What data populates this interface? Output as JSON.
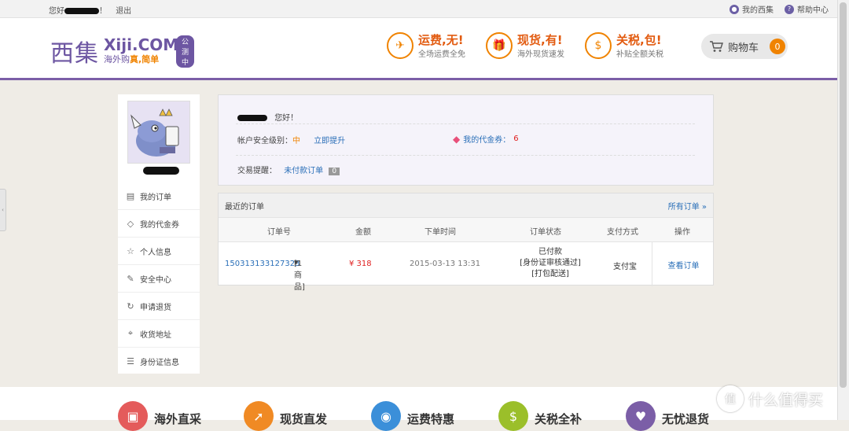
{
  "topbar": {
    "greeting": "您好",
    "greeting_suffix": "！",
    "logout": "退出",
    "my_xiji": "我的西集",
    "help": "帮助中心"
  },
  "logo": {
    "mark": "西集",
    "brand": "Xiji.COM",
    "beta": "公测中",
    "tagline_a": "海外购",
    "tagline_b": "真,简单"
  },
  "promos": [
    {
      "icon": "plane-icon",
      "glyph": "✈",
      "title": "运费,无!",
      "sub": "全场运费全免"
    },
    {
      "icon": "gift-icon",
      "glyph": "🎁",
      "title": "现货,有!",
      "sub": "海外现货速发"
    },
    {
      "icon": "money-bag-icon",
      "glyph": "$",
      "title": "关税,包!",
      "sub": "补贴全额关税"
    }
  ],
  "cart": {
    "label": "购物车",
    "count": "0"
  },
  "sidebar": {
    "items": [
      {
        "label": "我的订单",
        "icon": "order-icon",
        "glyph": "▤"
      },
      {
        "label": "我的代金券",
        "icon": "tag-icon",
        "glyph": "◇"
      },
      {
        "label": "个人信息",
        "icon": "star-icon",
        "glyph": "☆"
      },
      {
        "label": "安全中心",
        "icon": "edit-icon",
        "glyph": "✎"
      },
      {
        "label": "申请退货",
        "icon": "refresh-icon",
        "glyph": "↻"
      },
      {
        "label": "收货地址",
        "icon": "location-icon",
        "glyph": "⌖"
      },
      {
        "label": "身份证信息",
        "icon": "id-card-icon",
        "glyph": "☰"
      }
    ]
  },
  "welcome": {
    "hello": "您好！",
    "security_label": "帐户安全级别：",
    "security_level": "中",
    "upgrade": "立即提升",
    "coupon_label": "我的代金券：",
    "coupon_count": "6",
    "reminder_label": "交易提醒：",
    "unpaid_label": "未付款订单",
    "unpaid_count": "0"
  },
  "orders": {
    "title": "最近的订单",
    "all_link": "所有订单 »",
    "columns": [
      "订单号",
      "金额",
      "下单时间",
      "订单状态",
      "支付方式",
      "操作"
    ],
    "rows": [
      {
        "order_no": "150313133127323",
        "items": "[1商品]",
        "amount": "¥ 318",
        "time": "2015-03-13 13:31",
        "status_1": "已付款",
        "status_2": "[身份证审核通过]",
        "status_3": "[打包配送]",
        "payment": "支付宝",
        "action": "查看订单"
      }
    ]
  },
  "footer": [
    {
      "label": "海外直采",
      "color": "#e45b5b"
    },
    {
      "label": "现货直发",
      "color": "#f08a24"
    },
    {
      "label": "运费特惠",
      "color": "#3b8fd9"
    },
    {
      "label": "关税全补",
      "color": "#9bbf2a"
    },
    {
      "label": "无忧退货",
      "color": "#7b5ea7"
    }
  ],
  "watermark": "什么值得买",
  "colors": {
    "brand_purple": "#6d56a2",
    "accent_orange": "#f08300",
    "price_red": "#e02020",
    "link_blue": "#2a6fb8"
  }
}
